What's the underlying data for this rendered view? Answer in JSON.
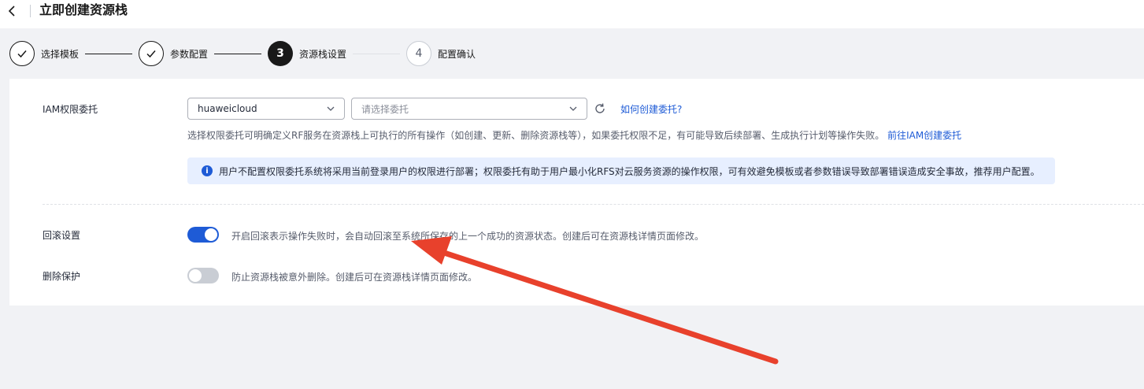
{
  "header": {
    "title": "立即创建资源栈"
  },
  "steps": [
    {
      "label": "选择模板",
      "state": "done"
    },
    {
      "label": "参数配置",
      "state": "done"
    },
    {
      "label": "资源栈设置",
      "number": "3",
      "state": "active"
    },
    {
      "label": "配置确认",
      "number": "4",
      "state": "todo"
    }
  ],
  "iam": {
    "label": "IAM权限委托",
    "provider_value": "huaweicloud",
    "delegation_placeholder": "请选择委托",
    "help_link": "如何创建委托?",
    "description": "选择权限委托可明确定义RF服务在资源栈上可执行的所有操作（如创建、更新、删除资源栈等），如果委托权限不足，有可能导致后续部署、生成执行计划等操作失败。",
    "create_link": "前往IAM创建委托",
    "alert_text": "用户不配置权限委托系统将采用当前登录用户的权限进行部署；权限委托有助于用户最小化RFS对云服务资源的操作权限，可有效避免模板或者参数错误导致部署错误造成安全事故，推荐用户配置。"
  },
  "rollback": {
    "label": "回滚设置",
    "enabled": true,
    "description": "开启回滚表示操作失败时，会自动回滚至系统所保存的上一个成功的资源状态。创建后可在资源栈详情页面修改。"
  },
  "deletion_protection": {
    "label": "删除保护",
    "enabled": false,
    "description": "防止资源栈被意外删除。创建后可在资源栈详情页面修改。"
  },
  "colors": {
    "accent": "#1e5bd6",
    "annotation_arrow": "#e8412c"
  }
}
